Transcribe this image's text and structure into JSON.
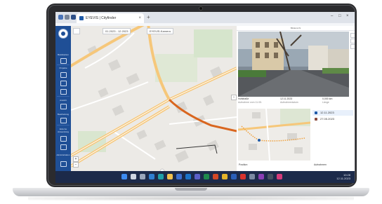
{
  "browser": {
    "tab_title": "EYEVIS | Cityfinder",
    "new_tab": "+",
    "tab_close": "×",
    "window_controls": [
      "–",
      "□",
      "×"
    ]
  },
  "sidebar": {
    "sections": [
      "Basiskarten",
      "Projekte",
      "Ansicht",
      "Bearbeitung",
      "Externe Anwendung",
      "Administration"
    ]
  },
  "map": {
    "date_range": "01.2023 - 12.2023",
    "layer_select": "EYEVIS-Kamera",
    "zoom_in": "+",
    "zoom_out": "−"
  },
  "detail": {
    "header": "Bildansicht",
    "info": [
      {
        "title": "Hofstraße",
        "sub": "Aufnahme vom 11.05."
      },
      {
        "title": "12.11.2023",
        "sub": "Aufnahmedatum"
      },
      {
        "title": "0,000 km",
        "sub": "Länge"
      }
    ],
    "list": [
      {
        "label": "12.11.2023",
        "color": "#1e5aa8"
      },
      {
        "label": "27.05.2023",
        "color": "#8a4a3b"
      }
    ],
    "footer_left": "Position",
    "footer_right": "Aufnahmen"
  },
  "taskbar": {
    "time": "10:28",
    "date": "12.11.2023"
  },
  "colors": {
    "sidebar": "#1f4f96",
    "route": "#d9661f",
    "taskbar": "#1c2a4a"
  }
}
